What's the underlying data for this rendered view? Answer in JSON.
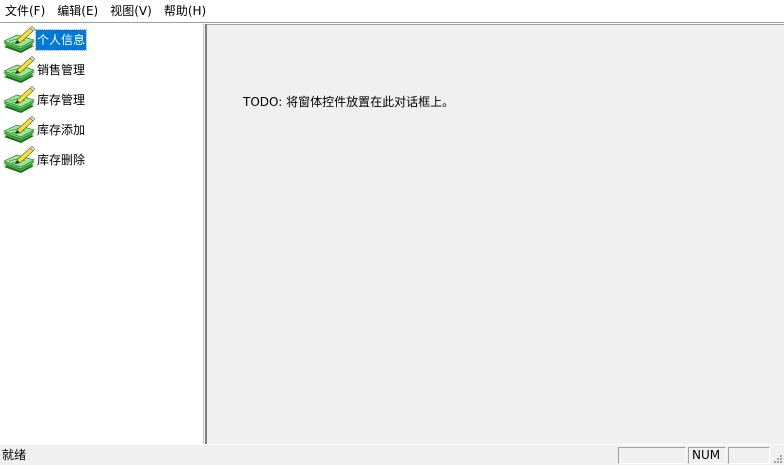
{
  "menubar": {
    "items": [
      {
        "label": "文件(F)"
      },
      {
        "label": "编辑(E)"
      },
      {
        "label": "视图(V)"
      },
      {
        "label": "帮助(H)"
      }
    ]
  },
  "tree": {
    "icon": "edit-document-icon",
    "items": [
      {
        "label": "个人信息",
        "selected": true
      },
      {
        "label": "销售管理",
        "selected": false
      },
      {
        "label": "库存管理",
        "selected": false
      },
      {
        "label": "库存添加",
        "selected": false
      },
      {
        "label": "库存删除",
        "selected": false
      }
    ]
  },
  "view": {
    "todo_text": "TODO: 将窗体控件放置在此对话框上。"
  },
  "statusbar": {
    "text": "就绪",
    "panes": [
      "",
      "NUM",
      ""
    ]
  },
  "colors": {
    "selection": "#0078d7",
    "view_background": "#f0f0f0",
    "tree_background": "#ffffff"
  }
}
